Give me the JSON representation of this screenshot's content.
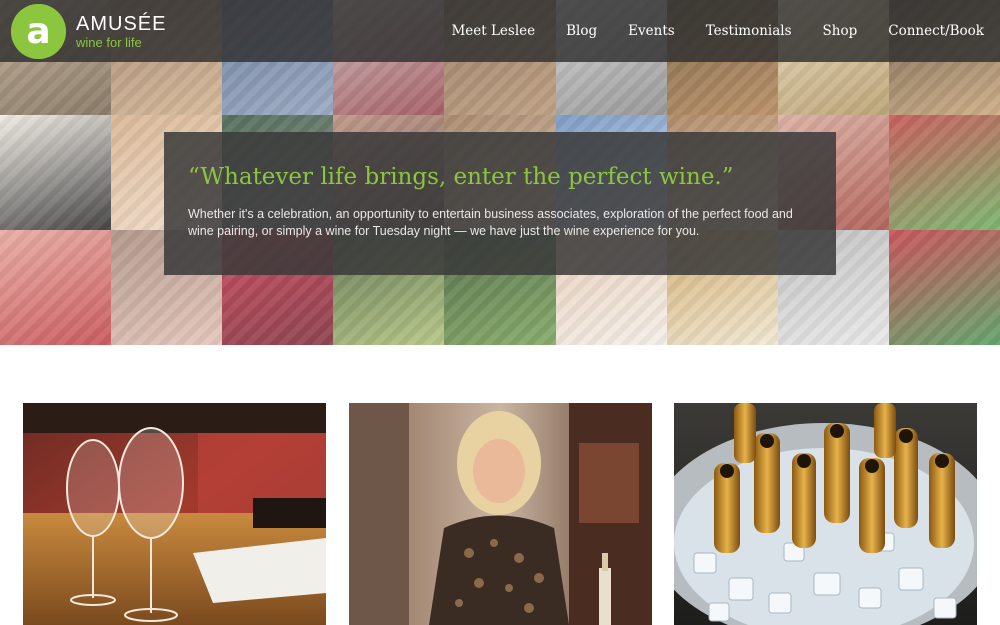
{
  "brand": {
    "logo_letter": "a",
    "name": "AMUSÉE",
    "tagline": "wine for life",
    "accent_color": "#8cc63f"
  },
  "nav": {
    "items": [
      {
        "label": "Meet Leslee"
      },
      {
        "label": "Blog"
      },
      {
        "label": "Events"
      },
      {
        "label": "Testimonials"
      },
      {
        "label": "Shop"
      },
      {
        "label": "Connect/Book"
      }
    ]
  },
  "hero": {
    "quote": "“Whatever life brings, enter the perfect wine.”",
    "body": "Whether it's a celebration, an opportunity to entertain business associates, exploration of the perfect food and wine pairing, or simply a wine for Tuesday night — we have just the wine experience for you."
  },
  "cards": [
    {
      "image": "wine-glasses-on-table"
    },
    {
      "image": "woman-smiling-with-wine"
    },
    {
      "image": "champagne-bottles-on-ice"
    }
  ]
}
